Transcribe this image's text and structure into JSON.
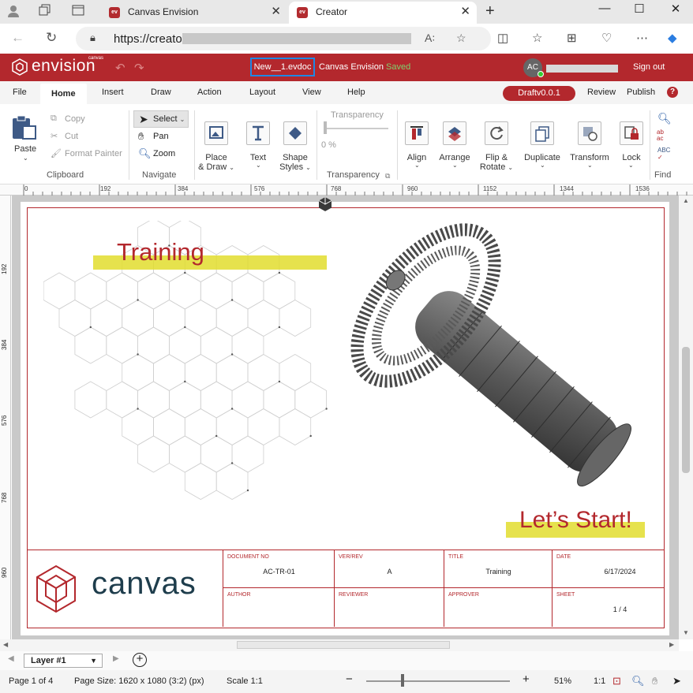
{
  "browser": {
    "tabs": [
      {
        "title": "Canvas Envision",
        "favicon": "ev"
      },
      {
        "title": "Creator",
        "favicon": "ev"
      }
    ],
    "url": "https://creator",
    "window_controls": [
      "minimize-icon",
      "maximize-icon",
      "close-icon"
    ]
  },
  "app": {
    "logo_text": "envision",
    "logo_sup": "canvas",
    "document_name": "New__1.evdoc",
    "app_name": "Canvas Envision",
    "save_status": "Saved",
    "avatar_initials": "AC",
    "sign_out": "Sign out",
    "colors": {
      "brand": "#b3282d",
      "saved": "#7ed36e",
      "highlight": "#e2dd2e",
      "focus": "#1e88e5"
    }
  },
  "ribbon_tabs": {
    "file": "File",
    "home": "Home",
    "insert": "Insert",
    "draw": "Draw",
    "action": "Action",
    "layout": "Layout",
    "view": "View",
    "help": "Help",
    "draft": "Draftv0.0.1",
    "review": "Review",
    "publish": "Publish",
    "help_icon": "?"
  },
  "ribbon": {
    "paste": "Paste",
    "copy": "Copy",
    "cut": "Cut",
    "format_painter": "Format Painter",
    "clipboard_group": "Clipboard",
    "select": "Select",
    "pan": "Pan",
    "zoom": "Zoom",
    "navigate_group": "Navigate",
    "place_draw_1": "Place",
    "place_draw_2": "& Draw",
    "text": "Text",
    "shape_styles_1": "Shape",
    "shape_styles_2": "Styles",
    "transparency_label": "Transparency",
    "transparency_value": "0 %",
    "transparency_group": "Transparency",
    "align": "Align",
    "arrange": "Arrange",
    "flip_1": "Flip &",
    "flip_2": "Rotate",
    "duplicate": "Duplicate",
    "transform": "Transform",
    "lock": "Lock",
    "find_group": "Find"
  },
  "ruler": {
    "h_ticks": [
      "0",
      "192",
      "384",
      "576",
      "768",
      "960",
      "1152",
      "1344",
      "1536"
    ],
    "v_ticks": [
      "192",
      "384",
      "576",
      "768",
      "960"
    ]
  },
  "sheet": {
    "heading_training": "Training",
    "heading_start": "Let’s Start!",
    "brand_word": "canvas",
    "title_block": {
      "doc_no_label": "DOCUMENT NO",
      "doc_no": "AC-TR-01",
      "ver_label": "VER/REV",
      "ver": "A",
      "title_label": "TITLE",
      "title": "Training",
      "date_label": "DATE",
      "date": "6/17/2024",
      "author_label": "AUTHOR",
      "author": "",
      "reviewer_label": "REVIEWER",
      "reviewer": "",
      "approver_label": "APPROVER",
      "approver": "",
      "sheet_label": "SHEET",
      "sheet": "1 / 4"
    }
  },
  "layer": {
    "name": "Layer #1"
  },
  "status": {
    "page": "Page 1 of 4",
    "page_size": "Page Size: 1620 x 1080 (3:2) (px)",
    "scale": "Scale 1:1",
    "zoom": "51%",
    "ratio": "1:1",
    "zoom_level": 0.25
  }
}
